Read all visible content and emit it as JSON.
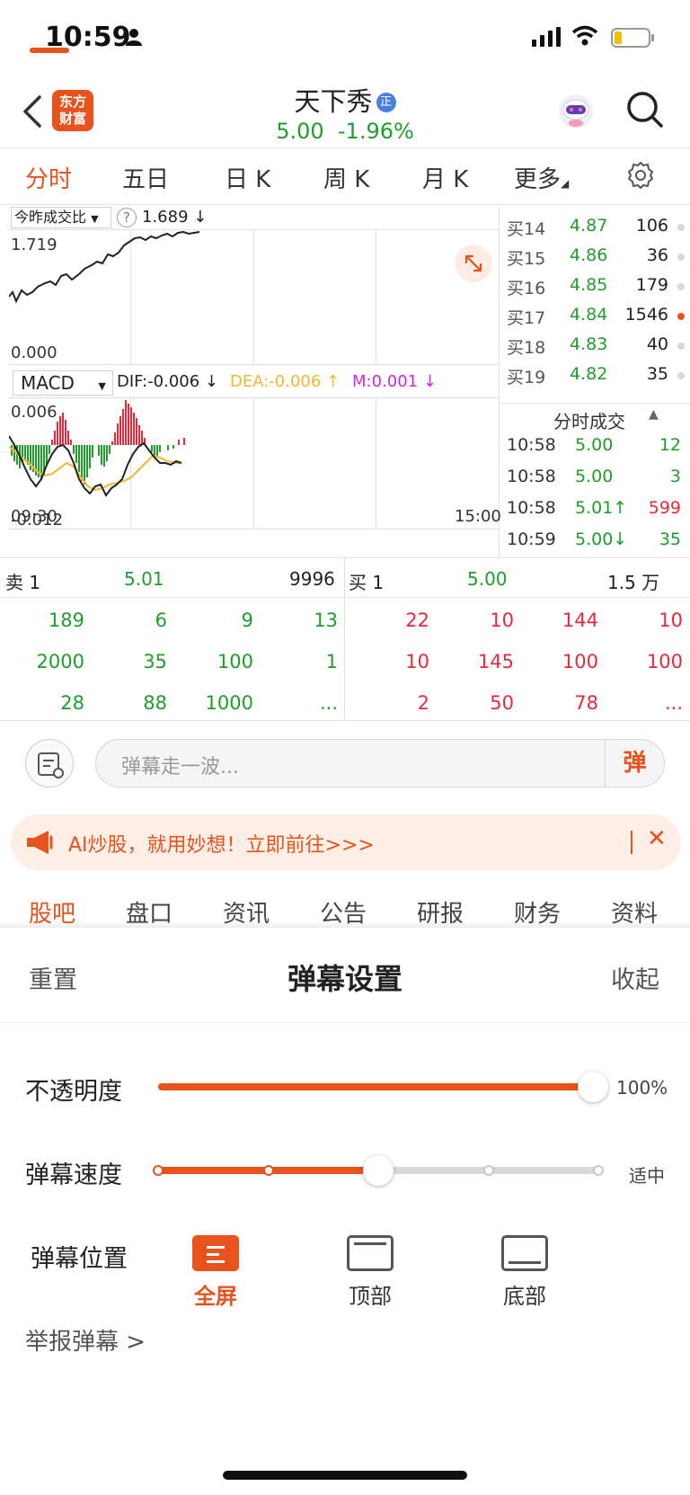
{
  "status_bar": {
    "time": "10:59"
  },
  "header": {
    "brand_line1": "东方",
    "brand_line2": "财富",
    "stock_name": "天下秀",
    "badge": "正",
    "price": "5.00",
    "change": "-1.96%"
  },
  "chart_tabs": [
    {
      "label": "分时",
      "active": true
    },
    {
      "label": "五日",
      "active": false
    },
    {
      "label": "日 K",
      "active": false
    },
    {
      "label": "周 K",
      "active": false
    },
    {
      "label": "月 K",
      "active": false
    },
    {
      "label": "更多",
      "active": false
    }
  ],
  "intraday": {
    "ratio_label": "今昨成交比",
    "ratio_value": "1.689 ↓",
    "top_label": "1.719",
    "bottom_label": "0.000",
    "macd_label": "MACD",
    "dif": "DIF:-0.006 ↓",
    "dea": "DEA:-0.006 ↑",
    "m": "M:0.001 ↓",
    "macd_top": "0.006",
    "macd_bottom": "-0.012",
    "time_start": "09:30",
    "time_end": "15:00"
  },
  "order_book": [
    {
      "label": "买14",
      "price": "4.87",
      "volume": "106",
      "hot": false
    },
    {
      "label": "买15",
      "price": "4.86",
      "volume": "36",
      "hot": false
    },
    {
      "label": "买16",
      "price": "4.85",
      "volume": "179",
      "hot": false
    },
    {
      "label": "买17",
      "price": "4.84",
      "volume": "1546",
      "hot": true
    },
    {
      "label": "买18",
      "price": "4.83",
      "volume": "40",
      "hot": false
    },
    {
      "label": "买19",
      "price": "4.82",
      "volume": "35",
      "hot": false
    }
  ],
  "trades": {
    "title": "分时成交",
    "rows": [
      {
        "time": "10:58",
        "price": "5.00",
        "volume": "12",
        "color": "green"
      },
      {
        "time": "10:58",
        "price": "5.00",
        "volume": "3",
        "color": "green"
      },
      {
        "time": "10:58",
        "price": "5.01↑",
        "volume": "599",
        "color": "red"
      },
      {
        "time": "10:59",
        "price": "5.00↓",
        "volume": "35",
        "color": "green"
      }
    ]
  },
  "level": {
    "sell_label": "卖 1",
    "sell_price": "5.01",
    "sell_volume": "9996",
    "buy_label": "买 1",
    "buy_price": "5.00",
    "buy_volume": "1.5 万",
    "sell_cells": [
      [
        "189",
        "6",
        "9",
        "13"
      ],
      [
        "2000",
        "35",
        "100",
        "1"
      ],
      [
        "28",
        "88",
        "1000",
        "..."
      ]
    ],
    "buy_cells": [
      [
        "22",
        "10",
        "144",
        "10"
      ],
      [
        "10",
        "145",
        "100",
        "100"
      ],
      [
        "2",
        "50",
        "78",
        "..."
      ]
    ]
  },
  "danmu": {
    "placeholder": "弹幕走一波...",
    "send_label": "弹"
  },
  "ai_banner": {
    "text": "AI炒股，就用妙想！立即前往>>>",
    "close": "✕"
  },
  "bottom_tabs": [
    {
      "label": "股吧",
      "active": true
    },
    {
      "label": "盘口",
      "active": false
    },
    {
      "label": "资讯",
      "active": false
    },
    {
      "label": "公告",
      "active": false
    },
    {
      "label": "研报",
      "active": false
    },
    {
      "label": "财务",
      "active": false
    },
    {
      "label": "资料",
      "active": false
    }
  ],
  "settings": {
    "reset": "重置",
    "title": "弹幕设置",
    "collapse": "收起",
    "opacity_label": "不透明度",
    "opacity_value": "100%",
    "opacity_level": 1.0,
    "speed_label": "弹幕速度",
    "speed_value": "适中",
    "speed_step": 2,
    "speed_steps_total": 5,
    "position_label": "弹幕位置",
    "positions": [
      {
        "label": "全屏",
        "active": true
      },
      {
        "label": "顶部",
        "active": false
      },
      {
        "label": "底部",
        "active": false
      }
    ],
    "report": "举报弹幕 >"
  },
  "colors": {
    "accent": "#e8521d",
    "up": "#e8293b",
    "down": "#1f9e2a"
  }
}
